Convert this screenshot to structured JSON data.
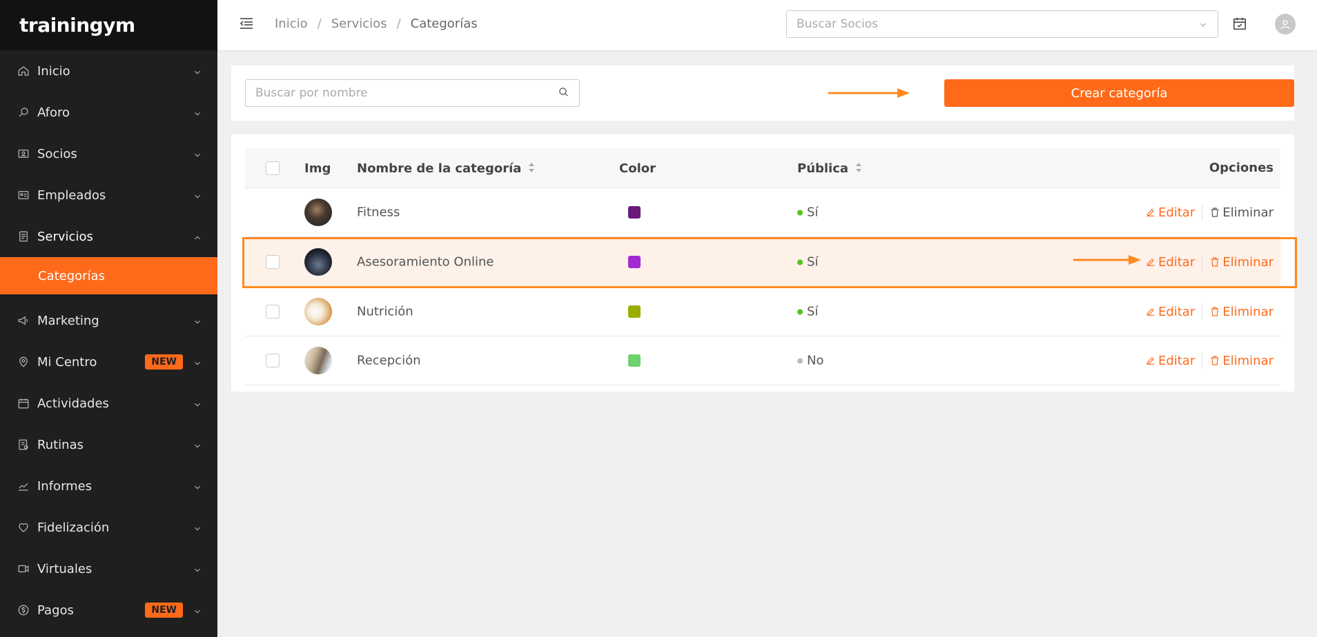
{
  "app": {
    "logo": "trainingym"
  },
  "sidebar": {
    "items": [
      {
        "label": "Inicio",
        "icon": "home-icon"
      },
      {
        "label": "Aforo",
        "icon": "search-icon"
      },
      {
        "label": "Socios",
        "icon": "id-card-icon"
      },
      {
        "label": "Empleados",
        "icon": "badge-icon"
      },
      {
        "label": "Servicios",
        "icon": "clipboard-icon",
        "open": true
      },
      {
        "label": "Marketing",
        "icon": "megaphone-icon"
      },
      {
        "label": "Mi Centro",
        "icon": "location-pin-icon",
        "badge": "NEW"
      },
      {
        "label": "Actividades",
        "icon": "calendar-icon"
      },
      {
        "label": "Rutinas",
        "icon": "routine-icon"
      },
      {
        "label": "Informes",
        "icon": "chart-line-icon"
      },
      {
        "label": "Fidelización",
        "icon": "heart-icon"
      },
      {
        "label": "Virtuales",
        "icon": "video-icon"
      },
      {
        "label": "Pagos",
        "icon": "coin-icon",
        "badge": "NEW"
      }
    ],
    "sub_active": "Categorías"
  },
  "header": {
    "breadcrumb": [
      "Inicio",
      "Servicios",
      "Categorías"
    ],
    "search_placeholder": "Buscar Socios"
  },
  "toolbar": {
    "search_placeholder": "Buscar por nombre",
    "create_label": "Crear categoría"
  },
  "table": {
    "columns": {
      "img": "Img",
      "name": "Nombre de la categoría",
      "color": "Color",
      "public": "Pública",
      "options": "Opciones"
    },
    "edit_label": "Editar",
    "delete_label": "Eliminar",
    "rows": [
      {
        "name": "Fitness",
        "color": "#6b1a7a",
        "public": "Sí",
        "public_color": "#52c41a"
      },
      {
        "name": "Asesoramiento Online",
        "color": "#a12ad1",
        "public": "Sí",
        "public_color": "#52c41a"
      },
      {
        "name": "Nutrición",
        "color": "#9aad00",
        "public": "Sí",
        "public_color": "#52c41a"
      },
      {
        "name": "Recepción",
        "color": "#6fd16f",
        "public": "No",
        "public_color": "#bbbbbb"
      }
    ]
  },
  "colors": {
    "accent": "#ff6a1a",
    "sidebar_bg": "#1f1f1f"
  }
}
